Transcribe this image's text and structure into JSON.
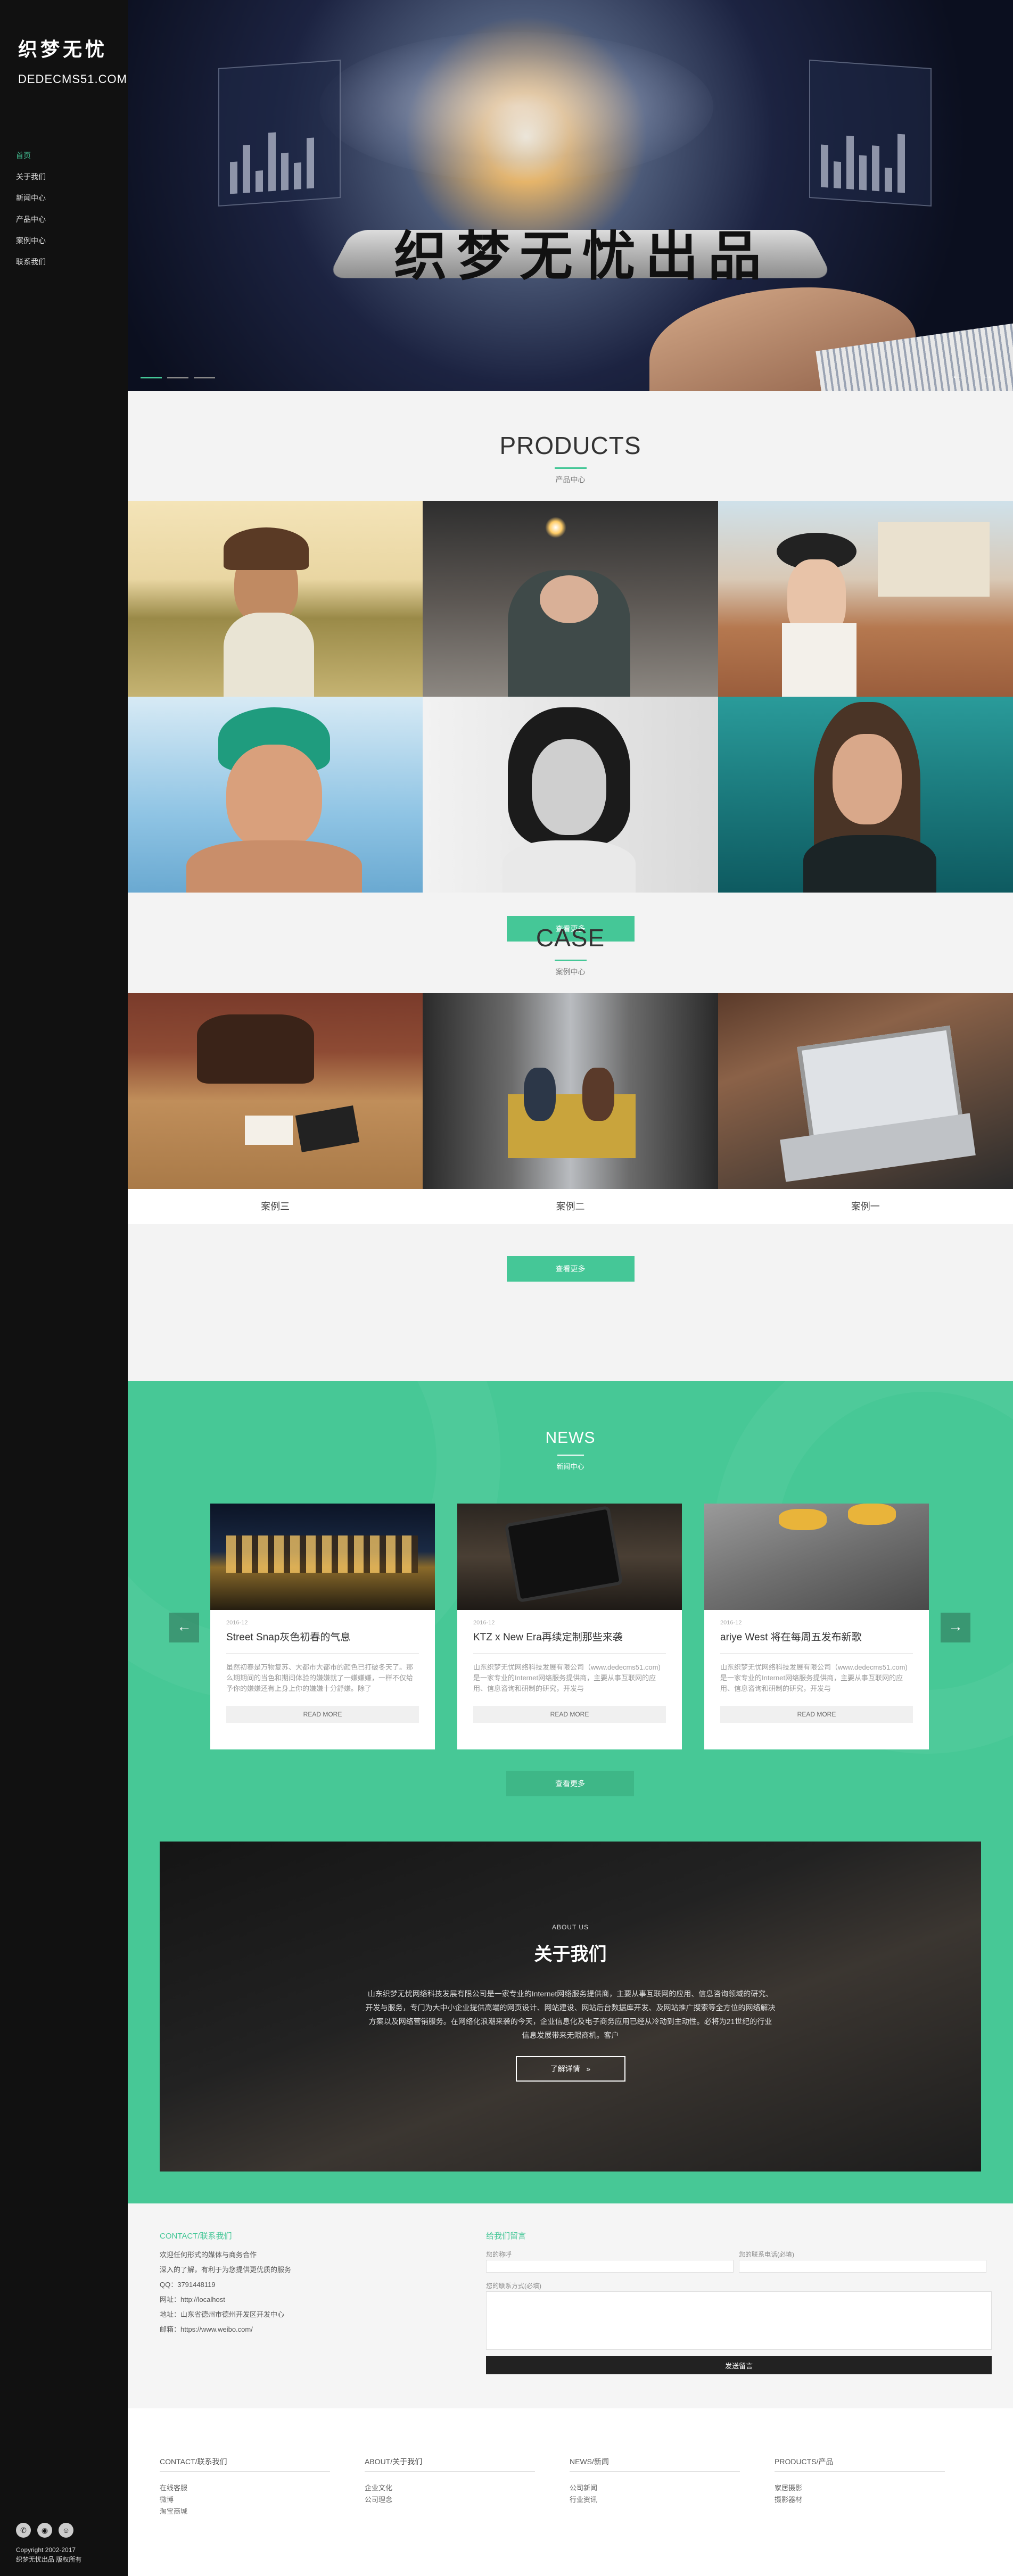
{
  "sidebar": {
    "logo_main": "织梦无忧",
    "logo_sub": "DEDECMS51.COM",
    "nav": [
      "首页",
      "关于我们",
      "新闻中心",
      "产品中心",
      "案例中心",
      "联系我们"
    ],
    "social_icons": [
      "weixin-icon",
      "weibo-icon",
      "qq-icon"
    ],
    "copyright": [
      "Copyright 2002-2017",
      "织梦无忧出品 版权所有"
    ]
  },
  "hero": {
    "title": "织梦无忧出品"
  },
  "products": {
    "title": "PRODUCTS",
    "subtitle": "产品中心",
    "more_label": "查看更多"
  },
  "case": {
    "title": "CASE",
    "subtitle": "案例中心",
    "items": [
      "案例三",
      "案例二",
      "案例一"
    ],
    "more_label": "查看更多"
  },
  "news": {
    "title": "NEWS",
    "subtitle": "新闻中心",
    "cards": [
      {
        "date": "2016-12",
        "title": "Street Snap灰色初春的气息",
        "desc": "虽然初春是万物复苏、大都市大都市的颜色已打破冬天了。那么期期间的当色和期间体验的嫌嫌就了一嫌嫌嫌，一样不仅给予你的嫌嫌还有上身上你的嫌嫌十分舒嫌。除了",
        "more": "READ MORE"
      },
      {
        "date": "2016-12",
        "title": "KTZ x New Era再续定制那些来袭",
        "desc": "山东织梦无忧网络科技发展有限公司（www.dedecms51.com)是一家专业的Internet网络服务提供商，主要从事互联网的应用、信息咨询和研制的研究，开发与",
        "more": "READ MORE"
      },
      {
        "date": "2016-12",
        "title": "ariye West 将在每周五发布新歌",
        "desc": "山东织梦无忧网络科技发展有限公司（www.dedecms51.com)是一家专业的Internet网络服务提供商，主要从事互联网的应用、信息咨询和研制的研究，开发与",
        "more": "READ MORE"
      }
    ],
    "more_label": "查看更多"
  },
  "about": {
    "label": "ABOUT US",
    "title": "关于我们",
    "text": "山东织梦无忧网络科技发展有限公司是一家专业的Internet网络服务提供商，主要从事互联网的应用、信息咨询领域的研究、开发与服务，专门为大中小企业提供高端的网页设计、网站建设、网站后台数据库开发、及网站推广搜索等全方位的网络解决方案以及网络营销服务。在网络化浪潮来袭的今天，企业信息化及电子商务应用已经从冷动到主动性。必将为21世纪的行业信息发展带来无限商机。客户",
    "button": "了解详情"
  },
  "contact": {
    "title": "CONTACT/联系我们",
    "lines": [
      "欢迎任何形式的媒体与商务合作",
      "深入的了解，有利于为您提供更优质的服务",
      "QQ：3791448119",
      "网址：http://localhost",
      "地址：山东省德州市德州开发区开发中心",
      "邮箱：https://www.weibo.com/"
    ],
    "form_title": "给我们留言",
    "name_label": "您的称呼",
    "phone_label": "您的联系电话(必填)",
    "message_label": "您的联系方式(必填)",
    "submit": "发送留言"
  },
  "footer": {
    "cols": [
      {
        "title": "CONTACT/联系我们",
        "links": [
          "在线客服",
          "微博",
          "淘宝商城"
        ]
      },
      {
        "title": "ABOUT/关于我们",
        "links": [
          "企业文化",
          "公司理念"
        ]
      },
      {
        "title": "NEWS/新闻",
        "links": [
          "公司新闻",
          "行业资讯"
        ]
      },
      {
        "title": "PRODUCTS/产品",
        "links": [
          "家居摄影",
          "摄影器材"
        ]
      }
    ]
  },
  "colors": {
    "accent": "#45c797",
    "sidebar_bg": "#111111",
    "news_bg": "#47c896"
  }
}
